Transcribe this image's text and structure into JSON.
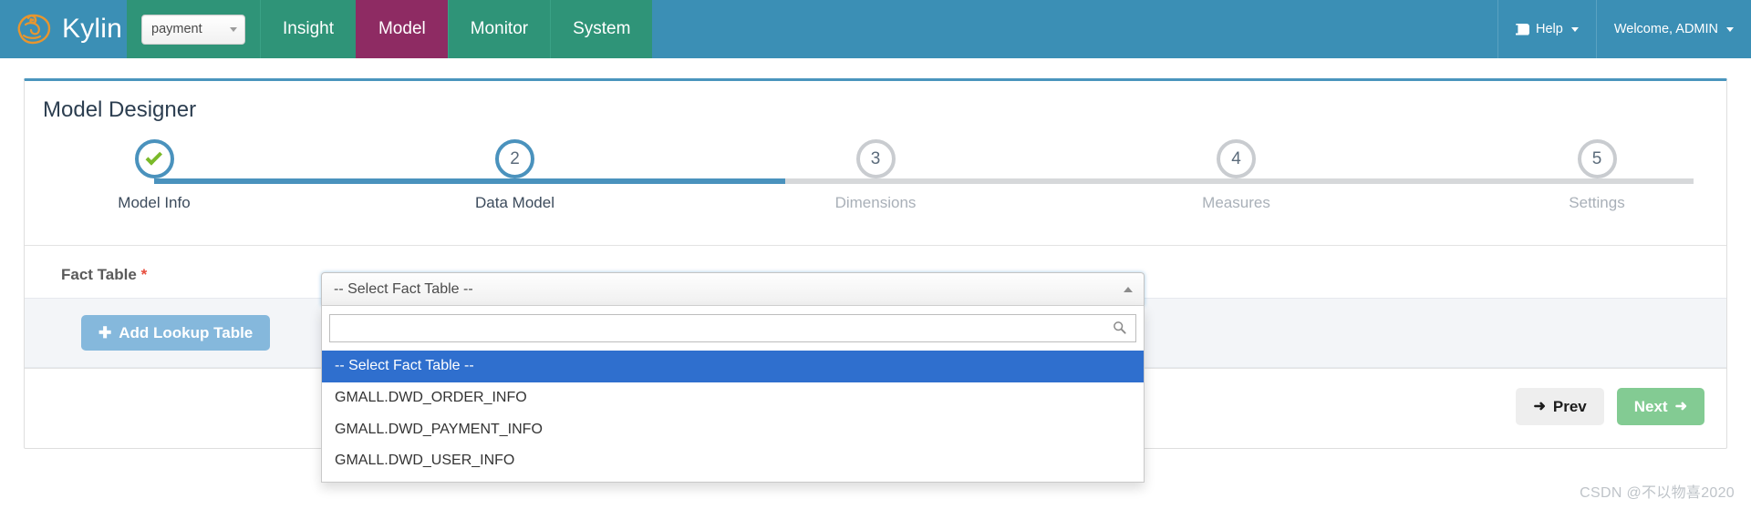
{
  "navbar": {
    "brand": "Kylin",
    "brand_logo_icon": "kylin-logo-icon",
    "project": {
      "value": "payment",
      "caret_icon": "chevron-down-icon"
    },
    "tabs": [
      {
        "label": "Insight",
        "active": false
      },
      {
        "label": "Model",
        "active": true
      },
      {
        "label": "Monitor",
        "active": false
      },
      {
        "label": "System",
        "active": false
      }
    ],
    "help": {
      "label": "Help",
      "icon": "book-icon",
      "caret_icon": "caret-down-icon"
    },
    "user": {
      "label": "Welcome, ADMIN",
      "caret_icon": "caret-down-icon"
    }
  },
  "panel": {
    "title": "Model Designer"
  },
  "wizard": {
    "steps": [
      {
        "number": "1",
        "label": "Model Info",
        "state": "done",
        "marker": "check-icon"
      },
      {
        "number": "2",
        "label": "Data Model",
        "state": "active",
        "marker": "2"
      },
      {
        "number": "3",
        "label": "Dimensions",
        "state": "todo",
        "marker": "3"
      },
      {
        "number": "4",
        "label": "Measures",
        "state": "todo",
        "marker": "4"
      },
      {
        "number": "5",
        "label": "Settings",
        "state": "todo",
        "marker": "5"
      }
    ]
  },
  "fact_table": {
    "label": "Fact Table",
    "required_mark": "*",
    "select": {
      "value": "-- Select Fact Table --",
      "caret_icon": "chevron-up-icon",
      "search": {
        "value": "",
        "placeholder": "",
        "icon": "search-icon"
      },
      "options": [
        {
          "label": "-- Select Fact Table --",
          "selected": true
        },
        {
          "label": "GMALL.DWD_ORDER_INFO",
          "selected": false
        },
        {
          "label": "GMALL.DWD_PAYMENT_INFO",
          "selected": false
        },
        {
          "label": "GMALL.DWD_USER_INFO",
          "selected": false
        }
      ]
    }
  },
  "lookup": {
    "add_button": {
      "label": "Add Lookup Table",
      "icon": "plus-icon"
    }
  },
  "footer": {
    "prev": {
      "label": "Prev",
      "icon": "arrow-left-icon"
    },
    "next": {
      "label": "Next",
      "icon": "arrow-right-icon"
    }
  },
  "watermark": "CSDN @不以物喜2020",
  "colors": {
    "navbar_blue": "#3b8fb5",
    "nav_green": "#2f9478",
    "active_tab_magenta": "#8e2b63",
    "step_blue": "#4a92bd",
    "check_green": "#7ab929",
    "option_highlight": "#2f6fce",
    "next_green": "#83cb93",
    "lookup_blue": "#85b8dc",
    "required_red": "#e74c3c"
  }
}
